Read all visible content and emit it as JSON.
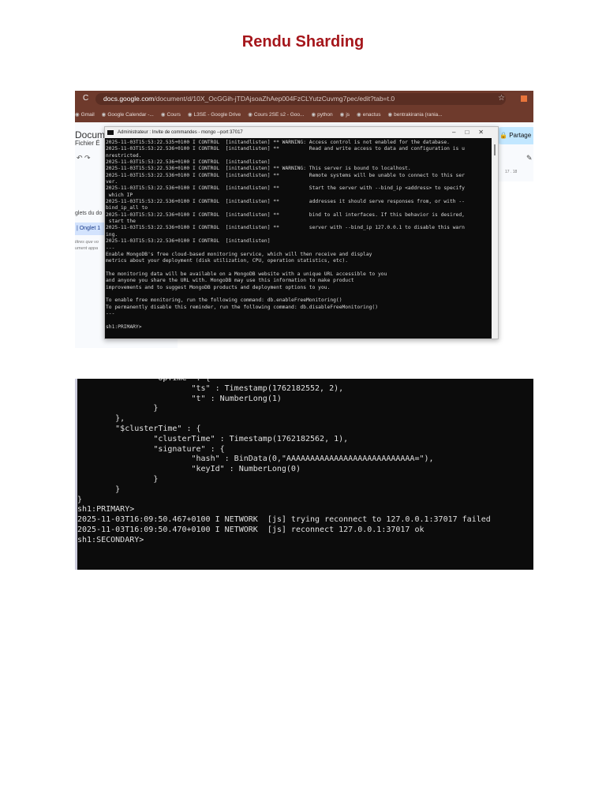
{
  "title": "Rendu Sharding",
  "screenshot1": {
    "browser": {
      "url_host": "docs.google.com",
      "url_path": "/document/d/10X_OcGGih-jTDAjsoaZhAep004FzCLYutzCuvmg7pec/edit?tab=t.0",
      "bookmarks": [
        "Gmail",
        "Google Calendar -...",
        "Cours",
        "L3SE - Google Drive",
        "Cours 2SE s2 - Goo...",
        "python",
        "js",
        "enactus",
        "bentrakirania (rania..."
      ]
    },
    "docs": {
      "doc_title": "Documer",
      "menu": "Fichier  É",
      "onglets": "glets du do",
      "tab": "Onglet 1",
      "hint": "titres que vo\nument appa",
      "share": "Partage",
      "ruler": "17 . 18"
    },
    "terminal": {
      "title": "Administrateur : Invite de commandes - mongo  --port 37017",
      "lines": [
        "2025-11-03T15:53:22.535+0100 I CONTROL  [initandlisten] ** WARNING: Access control is not enabled for the database.",
        "2025-11-03T15:53:22.536+0100 I CONTROL  [initandlisten] **          Read and write access to data and configuration is u",
        "nrestricted.",
        "2025-11-03T15:53:22.536+0100 I CONTROL  [initandlisten]",
        "2025-11-03T15:53:22.536+0100 I CONTROL  [initandlisten] ** WARNING: This server is bound to localhost.",
        "2025-11-03T15:53:22.536+0100 I CONTROL  [initandlisten] **          Remote systems will be unable to connect to this ser",
        "ver.",
        "2025-11-03T15:53:22.536+0100 I CONTROL  [initandlisten] **          Start the server with --bind_ip <address> to specify",
        " which IP",
        "2025-11-03T15:53:22.536+0100 I CONTROL  [initandlisten] **          addresses it should serve responses from, or with --",
        "bind_ip_all to",
        "2025-11-03T15:53:22.536+0100 I CONTROL  [initandlisten] **          bind to all interfaces. If this behavior is desired,",
        " start the",
        "2025-11-03T15:53:22.536+0100 I CONTROL  [initandlisten] **          server with --bind_ip 127.0.0.1 to disable this warn",
        "ing.",
        "2025-11-03T15:53:22.536+0100 I CONTROL  [initandlisten]",
        "---",
        "Enable MongoDB's free cloud-based monitoring service, which will then receive and display",
        "metrics about your deployment (disk utilization, CPU, operation statistics, etc).",
        "",
        "The monitoring data will be available on a MongoDB website with a unique URL accessible to you",
        "and anyone you share the URL with. MongoDB may use this information to make product",
        "improvements and to suggest MongoDB products and deployment options to you.",
        "",
        "To enable free monitoring, run the following command: db.enableFreeMonitoring()",
        "To permanently disable this reminder, run the following command: db.disableFreeMonitoring()",
        "---",
        "",
        "sh1:PRIMARY>"
      ]
    }
  },
  "screenshot2": {
    "lines": [
      "                \"opTime\" : {",
      "                        \"ts\" : Timestamp(1762182552, 2),",
      "                        \"t\" : NumberLong(1)",
      "                }",
      "        },",
      "        \"$clusterTime\" : {",
      "                \"clusterTime\" : Timestamp(1762182562, 1),",
      "                \"signature\" : {",
      "                        \"hash\" : BinData(0,\"AAAAAAAAAAAAAAAAAAAAAAAAAAA=\"),",
      "                        \"keyId\" : NumberLong(0)",
      "                }",
      "        }",
      "}",
      "sh1:PRIMARY>",
      "2025-11-03T16:09:50.467+0100 I NETWORK  [js] trying reconnect to 127.0.0.1:37017 failed",
      "2025-11-03T16:09:50.470+0100 I NETWORK  [js] reconnect 127.0.0.1:37017 ok",
      "sh1:SECONDARY>"
    ]
  }
}
